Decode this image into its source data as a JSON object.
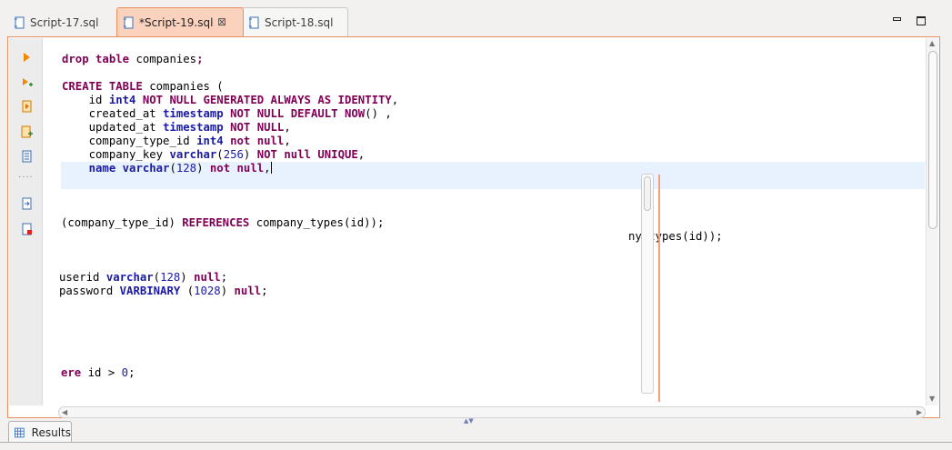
{
  "tabs": [
    {
      "label": "Script-17.sql",
      "active": false
    },
    {
      "label": "*Script-19.sql",
      "active": true
    },
    {
      "label": "Script-18.sql",
      "active": false
    }
  ],
  "tab_close_glyph": "⊠",
  "gutter_icons": [
    "execute-statement-icon",
    "execute-script-icon",
    "execute-script-new-tab-icon",
    "add-query-icon",
    "explain-plan-icon",
    "load-script-icon",
    "save-script-icon"
  ],
  "code_lines": [
    {
      "parts": [
        [
          "kw",
          "drop table "
        ],
        [
          "plain",
          "companies"
        ],
        [
          "kw",
          ";"
        ]
      ]
    },
    {
      "parts": [
        [
          "kw",
          "CREATE TABLE "
        ],
        [
          "plain",
          "companies ("
        ]
      ]
    },
    {
      "parts": [
        [
          "plain",
          "    id "
        ],
        [
          "ty",
          "int4 "
        ],
        [
          "kw",
          "NOT NULL GENERATED ALWAYS AS IDENTITY"
        ],
        [
          "plain",
          ","
        ]
      ]
    },
    {
      "parts": [
        [
          "plain",
          "    created_at "
        ],
        [
          "ty",
          "timestamp "
        ],
        [
          "kw",
          "NOT NULL DEFAULT NOW"
        ],
        [
          "plain",
          "() ,"
        ]
      ]
    },
    {
      "parts": [
        [
          "plain",
          "    updated_at "
        ],
        [
          "ty",
          "timestamp "
        ],
        [
          "kw",
          "NOT NULL"
        ],
        [
          "plain",
          ","
        ]
      ]
    },
    {
      "parts": [
        [
          "plain",
          "    company_type_id "
        ],
        [
          "ty",
          "int4 "
        ],
        [
          "kw",
          "not null"
        ],
        [
          "plain",
          ","
        ]
      ]
    },
    {
      "parts": [
        [
          "plain",
          "    company_key "
        ],
        [
          "ty",
          "varchar"
        ],
        [
          "plain",
          "("
        ],
        [
          "num",
          "256"
        ],
        [
          "plain",
          ") "
        ],
        [
          "kw",
          "NOT null UNIQUE"
        ],
        [
          "plain",
          ","
        ]
      ]
    },
    {
      "parts": [
        [
          "plain",
          "    "
        ],
        [
          "ty",
          "name varchar"
        ],
        [
          "plain",
          "("
        ],
        [
          "num",
          "128"
        ],
        [
          "plain",
          ") "
        ],
        [
          "kw",
          "not null"
        ],
        [
          "plain",
          ","
        ]
      ]
    },
    {
      "parts": [
        [
          "plain",
          "(company_type_id) "
        ],
        [
          "kw",
          "REFERENCES "
        ],
        [
          "plain",
          "company_types(id));"
        ]
      ]
    },
    {
      "parts": [
        [
          "plain",
          "ny_types(id));"
        ]
      ]
    },
    {
      "parts": [
        [
          "plain",
          "userid "
        ],
        [
          "ty",
          "varchar"
        ],
        [
          "plain",
          "("
        ],
        [
          "num",
          "128"
        ],
        [
          "plain",
          ") "
        ],
        [
          "kw",
          "null"
        ],
        [
          "plain",
          ";"
        ]
      ]
    },
    {
      "parts": [
        [
          "plain",
          "password "
        ],
        [
          "ty",
          "VARBINARY "
        ],
        [
          "plain",
          "("
        ],
        [
          "num",
          "1028"
        ],
        [
          "plain",
          ") "
        ],
        [
          "kw",
          "null"
        ],
        [
          "plain",
          ";"
        ]
      ]
    },
    {
      "parts": [
        [
          "kw",
          "ere "
        ],
        [
          "plain",
          "id > "
        ],
        [
          "num",
          "0"
        ],
        [
          "plain",
          ";"
        ]
      ]
    }
  ],
  "results_tab_label": "Results",
  "colors": {
    "accent": "#e8905f",
    "active_tab": "#fbd2bd",
    "keyword": "#7f0055",
    "type": "#1a1aa6",
    "cursor_line": "#e8f2fe"
  }
}
